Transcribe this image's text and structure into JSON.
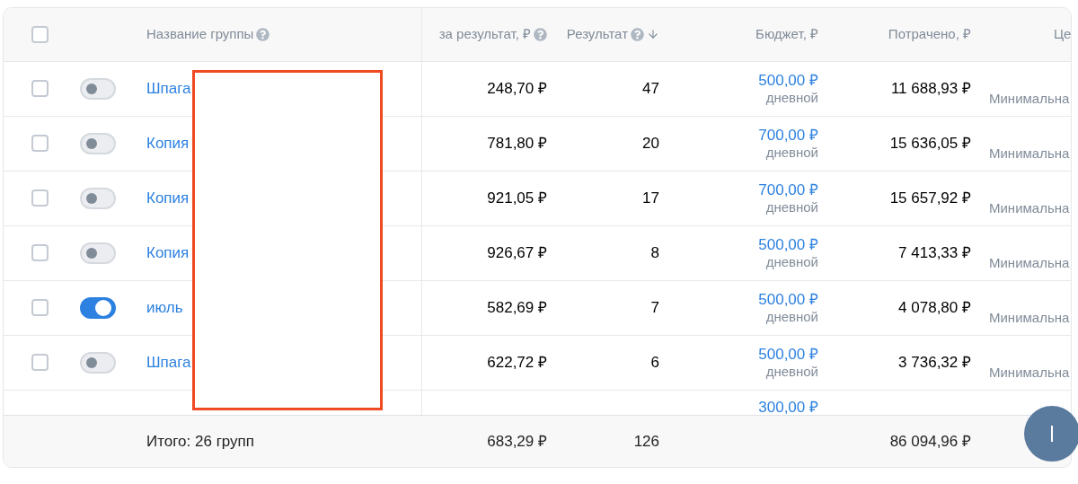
{
  "table": {
    "select_all": {
      "checked": false
    },
    "columns": [
      {
        "label": "Название группы",
        "help": true,
        "sorted": false
      },
      {
        "label": "за результат, ₽",
        "help": true,
        "sorted": false
      },
      {
        "label": "Результат",
        "help": true,
        "sorted": true
      },
      {
        "label": "Бюджет, ₽",
        "help": false,
        "sorted": false
      },
      {
        "label": "Потрачено, ₽",
        "help": false,
        "sorted": false
      },
      {
        "label": "Це",
        "help": false,
        "sorted": false
      }
    ],
    "rows": [
      {
        "checked": false,
        "on": false,
        "name": "Шпага",
        "cost": "248,70 ₽",
        "result": "47",
        "budget": "500,00 ₽",
        "budget_period": "дневной",
        "spent": "11 688,93 ₽",
        "column_8": "Минимальна"
      },
      {
        "checked": false,
        "on": false,
        "name": "Копия",
        "cost": "781,80 ₽",
        "result": "20",
        "budget": "700,00 ₽",
        "budget_period": "дневной",
        "spent": "15 636,05 ₽",
        "column_8": "Минимальна"
      },
      {
        "checked": false,
        "on": false,
        "name": "Копия",
        "cost": "921,05 ₽",
        "result": "17",
        "budget": "700,00 ₽",
        "budget_period": "дневной",
        "spent": "15 657,92 ₽",
        "column_8": "Минимальна"
      },
      {
        "checked": false,
        "on": false,
        "name": "Копия",
        "cost": "926,67 ₽",
        "result": "8",
        "budget": "500,00 ₽",
        "budget_period": "дневной",
        "spent": "7 413,33 ₽",
        "column_8": "Минимальна"
      },
      {
        "checked": false,
        "on": true,
        "name": "июль",
        "cost": "582,69 ₽",
        "result": "7",
        "budget": "500,00 ₽",
        "budget_period": "дневной",
        "spent": "4 078,80 ₽",
        "column_8": "Минимальна"
      },
      {
        "checked": false,
        "on": false,
        "name": "Шпага",
        "cost": "622,72 ₽",
        "result": "6",
        "budget": "500,00 ₽",
        "budget_period": "дневной",
        "spent": "3 736,32 ₽",
        "column_8": "Минимальна"
      },
      {
        "kind": "partial",
        "budget": "300,00 ₽"
      }
    ],
    "footer": {
      "label": "Итого: 26 групп",
      "cost": "683,29 ₽",
      "result": "126",
      "spent": "86 094,96 ₽"
    }
  }
}
